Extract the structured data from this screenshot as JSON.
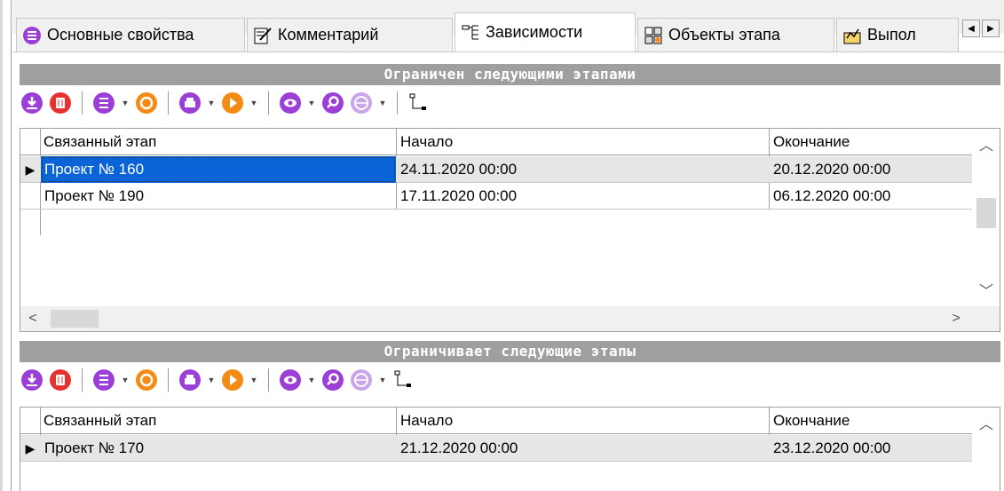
{
  "tabs": [
    {
      "label": "Основные свойства",
      "icon": "properties-icon"
    },
    {
      "label": "Комментарий",
      "icon": "comment-icon"
    },
    {
      "label": "Зависимости",
      "icon": "dependencies-icon",
      "active": true
    },
    {
      "label": "Объекты этапа",
      "icon": "stage-objects-icon"
    },
    {
      "label": "Выпол",
      "icon": "execution-icon"
    }
  ],
  "top_section": {
    "title": "Ограничен следующими этапами",
    "columns": [
      "Связанный этап",
      "Начало",
      "Окончание"
    ],
    "rows": [
      {
        "stage": "Проект № 160",
        "start": "24.11.2020 00:00",
        "end": "20.12.2020 00:00"
      },
      {
        "stage": "Проект № 190",
        "start": "17.11.2020 00:00",
        "end": "06.12.2020 00:00"
      }
    ]
  },
  "bottom_section": {
    "title": "Ограничивает следующие этапы",
    "columns": [
      "Связанный этап",
      "Начало",
      "Окончание"
    ],
    "rows": [
      {
        "stage": "Проект № 170",
        "start": "21.12.2020 00:00",
        "end": "23.12.2020 00:00"
      }
    ]
  },
  "colors": {
    "accent_purple": "#9b3fd6",
    "accent_red": "#e8322f",
    "accent_orange": "#f58a14",
    "selection": "#0a64d8",
    "header_bar": "#9f9f9f"
  }
}
